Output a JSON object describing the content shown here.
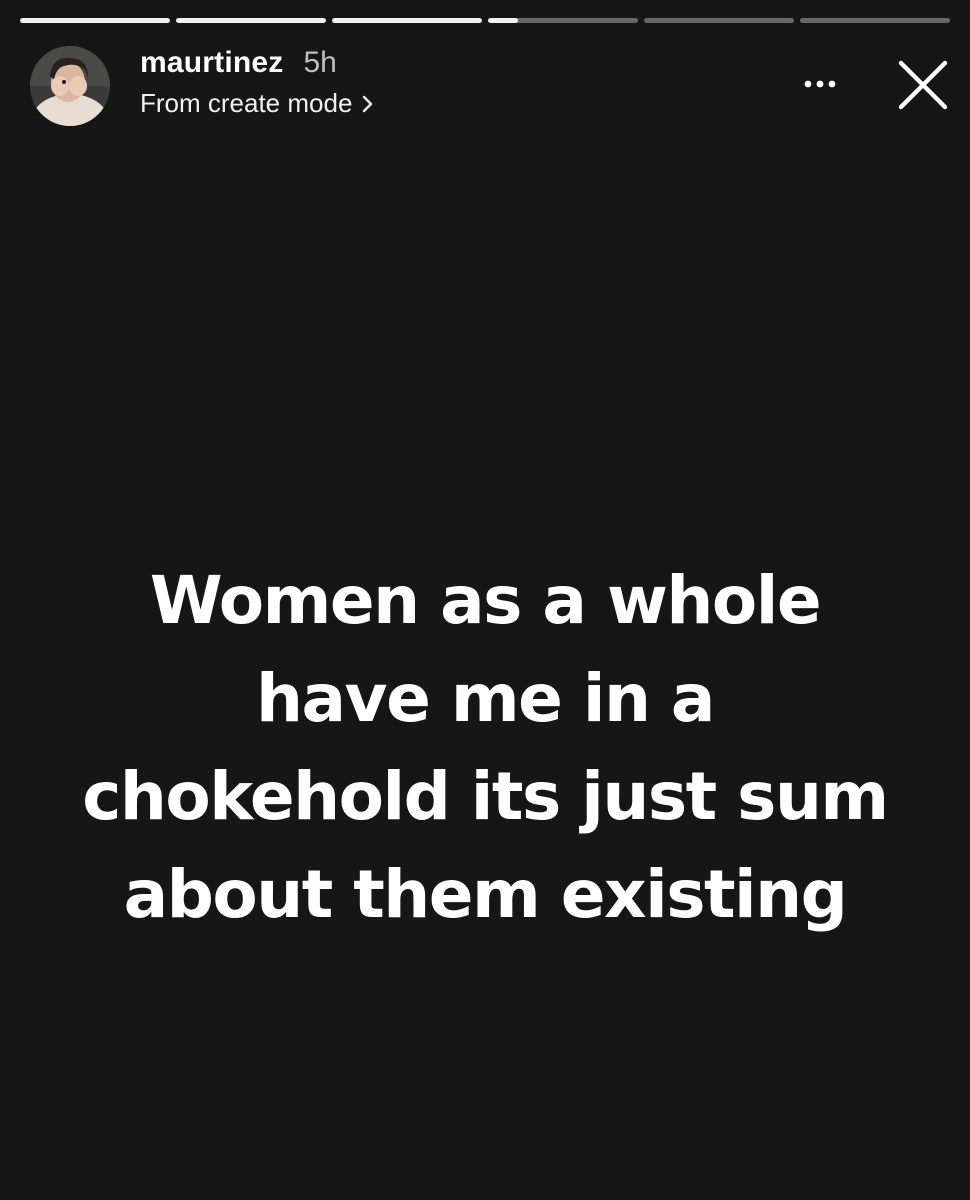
{
  "story": {
    "progress_segments": [
      1,
      1,
      1,
      0.2,
      0,
      0
    ],
    "progress_color": "#f2f2f2",
    "background_color": "#161616"
  },
  "header": {
    "username": "maurtinez",
    "time_ago": "5h",
    "subtitle": "From create mode",
    "subtitle_icon": "chevron-right-icon",
    "more_icon": "more-horizontal-icon",
    "close_icon": "close-icon"
  },
  "caption": {
    "text": "Women as a whole\nhave me in a\nchokehold its just sum\nabout them existing"
  }
}
